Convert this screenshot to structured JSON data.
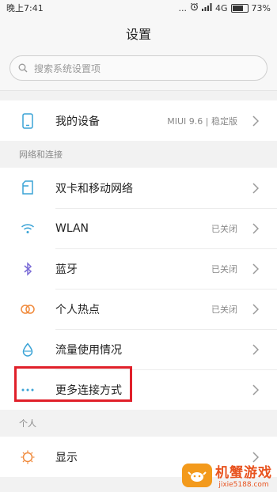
{
  "status_bar": {
    "time": "晚上7:41",
    "dots": "...",
    "network": "4G",
    "battery": "73%",
    "battery_level": 0.73
  },
  "header": {
    "title": "设置"
  },
  "search": {
    "placeholder": "搜索系统设置项"
  },
  "device_row": {
    "label": "我的设备",
    "value": "MIUI 9.6 | 稳定版",
    "icon": "phone-icon"
  },
  "network_section": {
    "header": "网络和连接",
    "items": [
      {
        "label": "双卡和移动网络",
        "value": "",
        "icon": "sim-icon"
      },
      {
        "label": "WLAN",
        "value": "已关闭",
        "icon": "wifi-icon"
      },
      {
        "label": "蓝牙",
        "value": "已关闭",
        "icon": "bluetooth-icon"
      },
      {
        "label": "个人热点",
        "value": "已关闭",
        "icon": "hotspot-icon"
      },
      {
        "label": "流量使用情况",
        "value": "",
        "icon": "data-usage-icon"
      },
      {
        "label": "更多连接方式",
        "value": "",
        "icon": "more-icon"
      }
    ]
  },
  "personal_section": {
    "header": "个人",
    "items": [
      {
        "label": "显示",
        "value": "",
        "icon": "display-icon"
      }
    ]
  },
  "watermark": {
    "title": "机蟹游戏",
    "subtitle": "jixie5188.com"
  },
  "colors": {
    "accent": "#3aa3d6",
    "highlight": "#e0202a",
    "watermark": "#e8531f"
  }
}
